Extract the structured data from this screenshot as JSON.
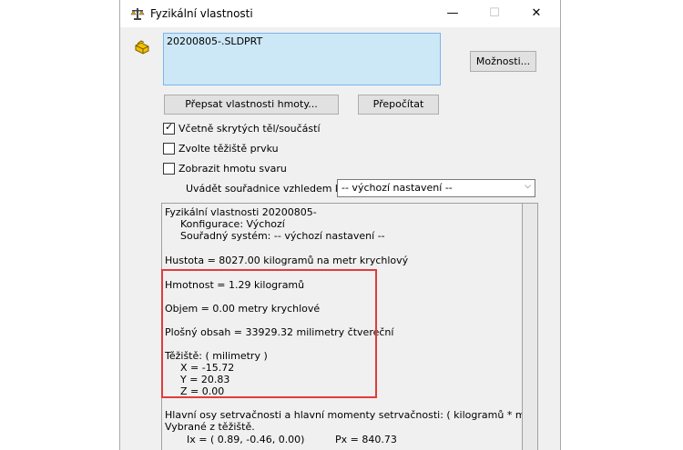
{
  "window": {
    "title": "Fyzikální vlastnosti",
    "minimize": "—",
    "maximize": "☐",
    "close": "✕"
  },
  "selection": {
    "items": [
      "20200805-.SLDPRT"
    ],
    "options_label": "Možnosti..."
  },
  "buttons": {
    "override_label": "Přepsat vlastnosti hmoty...",
    "recalc_label": "Přepočítat"
  },
  "checkboxes": [
    {
      "label": "Včetně skrytých těl/součástí",
      "checked": true
    },
    {
      "label": "Zvolte těžiště prvku",
      "checked": false
    },
    {
      "label": "Zobrazit hmotu svaru",
      "checked": false
    }
  ],
  "coordinates": {
    "label": "Uvádět souřadnice vzhledem k:",
    "selected": "-- výchozí nastavení --"
  },
  "results": {
    "header": "Fyzikální vlastnosti 20200805-",
    "configuration": "Konfigurace: Výchozí",
    "coord_system": "Souřadný systém: -- výchozí nastavení --",
    "density": "Hustota = 8027.00 kilogramů na  metr krychlový",
    "mass": "Hmotnost = 1.29 kilogramů",
    "volume": "Objem = 0.00 metry krychlové",
    "area": "Plošný obsah = 33929.32  milimetry čtvereční",
    "cog_header": "Těžiště: ( milimetry )",
    "x": "X = -15.72",
    "y": "Y = 20.83",
    "z": "Z = 0.00",
    "axes_header": "Hlavní osy setrvačnosti a hlavní momenty setrvačnosti: ( kilogramů *  milimetry čtvereční )",
    "axes_sub": "Vybrané z těžiště.",
    "ix": "Ix = ( 0.89, -0.46, 0.00)",
    "px": "Px = 840.73"
  },
  "colors": {
    "highlight": "#e03c3c",
    "selection_bg": "#cce8f7"
  }
}
